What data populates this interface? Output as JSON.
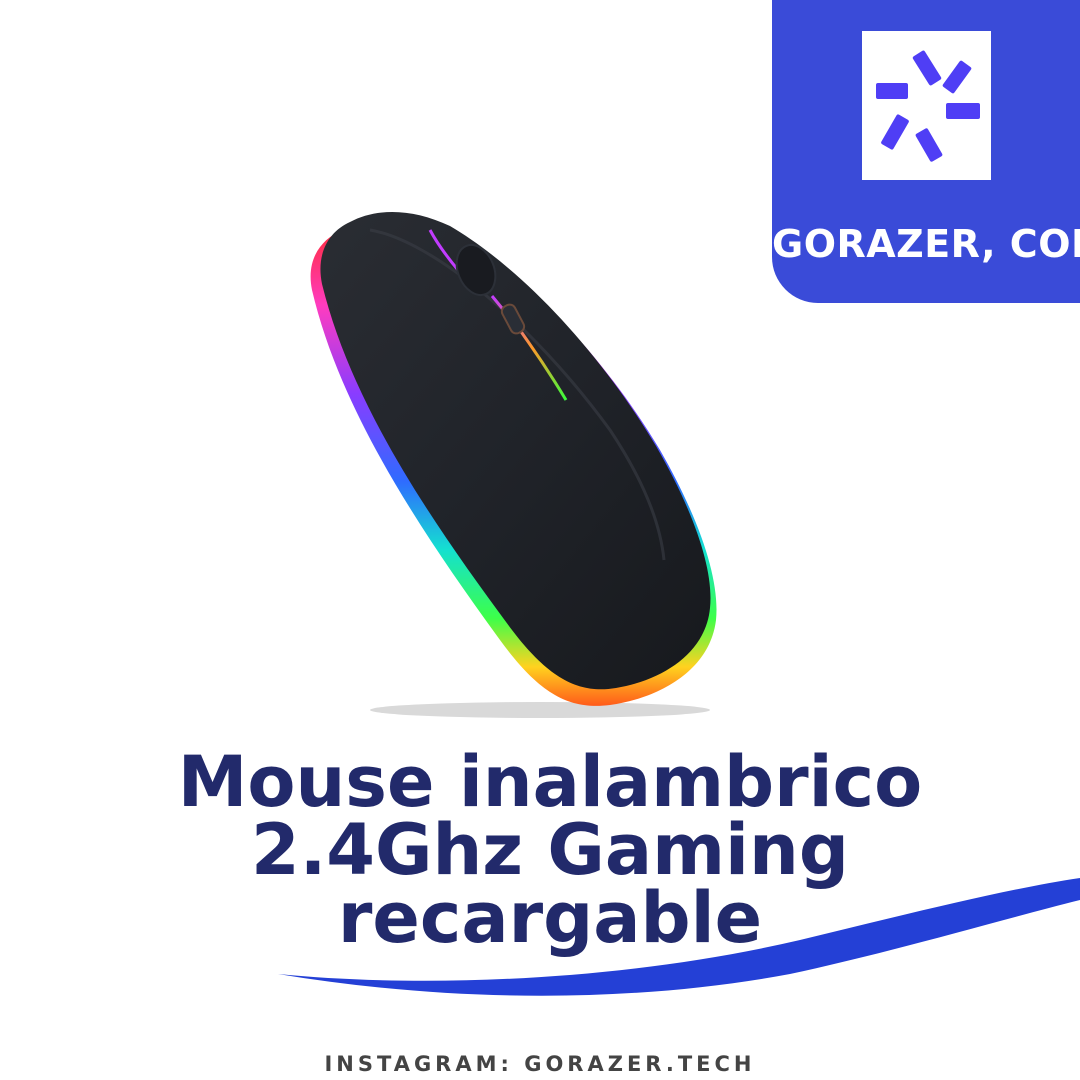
{
  "brand": {
    "name": "GORAZER, CORP",
    "logo_icon": "pinwheel-logo-icon",
    "panel_color": "#3a4bd8",
    "logo_color": "#4f3ef5"
  },
  "product": {
    "image_icon": "wireless-mouse-rgb-image",
    "title_lines": [
      "Mouse inalambrico",
      "2.4Ghz Gaming",
      "recargable"
    ],
    "title_color": "#222a6b"
  },
  "footer": {
    "instagram": "INSTAGRAM: GORAZER.TECH"
  },
  "decoration": {
    "wave_color": "#2440d6"
  }
}
